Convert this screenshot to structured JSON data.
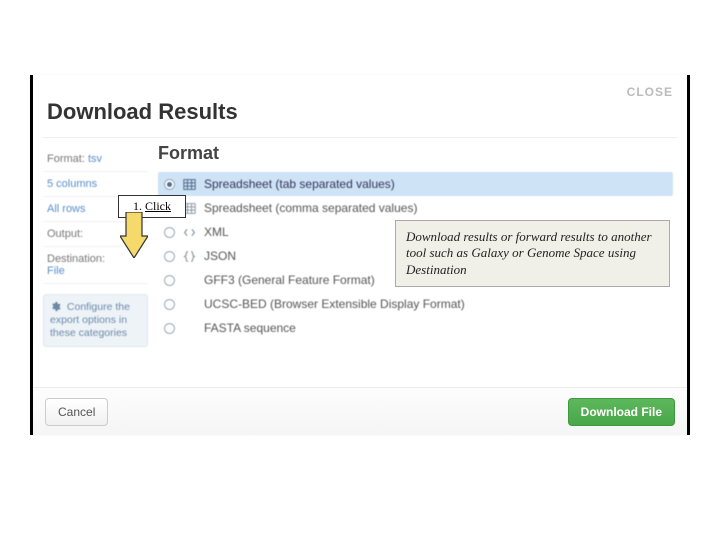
{
  "modal": {
    "title": "Download Results",
    "close_label": "CLOSE"
  },
  "sidebar": {
    "rows": [
      {
        "label": "Format:",
        "value": "tsv"
      },
      {
        "label": "",
        "value": "5 columns"
      },
      {
        "label": "",
        "value": "All rows"
      },
      {
        "label": "Output:",
        "value": ""
      },
      {
        "label": "Destination:",
        "value": "File"
      }
    ],
    "tip_text": "Configure the export options in these categories"
  },
  "main": {
    "section_title": "Format",
    "options": [
      {
        "label": "Spreadsheet (tab separated values)",
        "icon": "grid-icon",
        "selected": true
      },
      {
        "label": "Spreadsheet (comma separated values)",
        "icon": "grid-icon",
        "selected": false
      },
      {
        "label": "XML",
        "icon": "code-icon",
        "selected": false
      },
      {
        "label": "JSON",
        "icon": "braces-icon",
        "selected": false
      },
      {
        "label": "GFF3 (General Feature Format)",
        "icon": "blank-icon",
        "selected": false
      },
      {
        "label": "UCSC-BED (Browser Extensible Display Format)",
        "icon": "blank-icon",
        "selected": false
      },
      {
        "label": "FASTA sequence",
        "icon": "blank-icon",
        "selected": false
      }
    ]
  },
  "footer": {
    "cancel_label": "Cancel",
    "download_label": "Download File"
  },
  "annotations": {
    "click_label_num": "1.",
    "click_label_text": "Click",
    "desc_text": "Download results or forward results to another tool such as Galaxy or Genome Space using Destination"
  }
}
